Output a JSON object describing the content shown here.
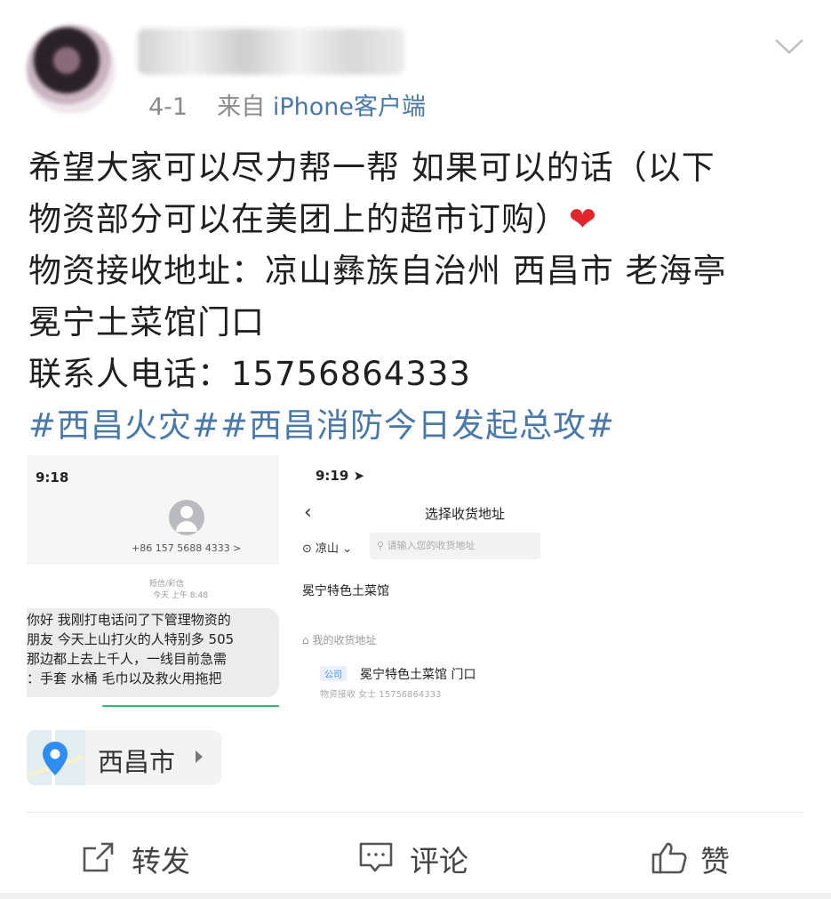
{
  "post": {
    "date": "4-1",
    "source_prefix": "来自",
    "source_name": "iPhone客户端",
    "text_lines": [
      "希望大家可以尽力帮一帮 如果可以的话（以下",
      "物资部分可以在美团上的超市订购）",
      "物资接收地址：凉山彝族自治州 西昌市 老海亭",
      "冕宁土菜馆门口",
      "联系人电话：15756864333"
    ],
    "heart": "❤",
    "hashtags": "#西昌火灾##西昌消防今日发起总攻#"
  },
  "screenshot_left": {
    "time": "9:18",
    "phone": "+86 157 5688 4333 >",
    "sms_label": "短信/彩信",
    "date": "今天 上午 8:48",
    "message_lines": [
      "你好 我刚打电话问了下管理物资的",
      "朋友 今天上山打火的人特别多 505",
      "那边都上去上千人，一线目前急需",
      "：手套 水桶 毛巾以及救火用拖把"
    ]
  },
  "screenshot_right": {
    "time": "9:19 ➤",
    "back": "‹",
    "title": "选择收货地址",
    "city": "凉山",
    "search_placeholder": "请输入您的收货地址",
    "shop": "冕宁特色土菜馆",
    "my_address_label": "我的收货地址",
    "tag": "公司",
    "address": "冕宁特色土菜馆 门口",
    "contact": "物资接收   女士      15756864333"
  },
  "location": {
    "label": "西昌市"
  },
  "actions": {
    "repost": "转发",
    "comment": "评论",
    "like": "赞"
  },
  "colors": {
    "link": "#4a78a8",
    "heart": "#e0262b",
    "text": "#1f1f1f",
    "meta": "#8a8a8a"
  }
}
